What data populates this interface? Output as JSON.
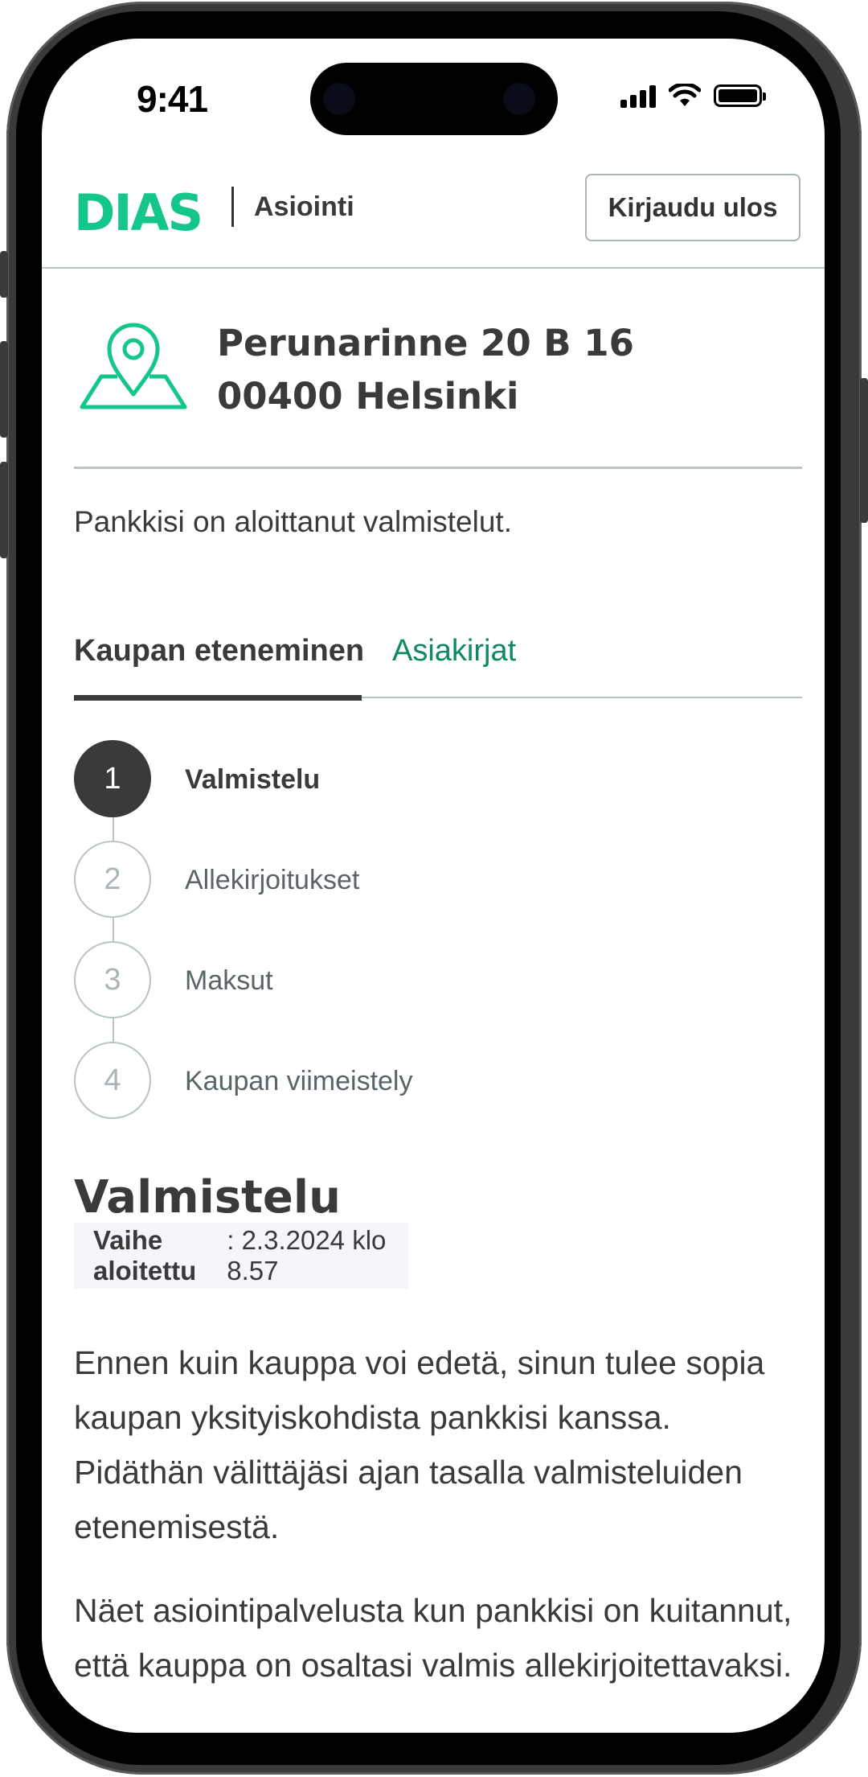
{
  "status_bar": {
    "time": "9:41"
  },
  "header": {
    "logo": "DIAS",
    "subtitle": "Asiointi",
    "logout_label": "Kirjaudu ulos"
  },
  "address": {
    "street": "Perunarinne 20 B 16",
    "city": "00400 Helsinki"
  },
  "status_message": "Pankkisi on aloittanut valmistelut.",
  "tabs": [
    {
      "label": "Kaupan eteneminen",
      "active": true
    },
    {
      "label": "Asiakirjat",
      "active": false
    }
  ],
  "steps": [
    {
      "number": "1",
      "label": "Valmistelu",
      "state": "current"
    },
    {
      "number": "2",
      "label": "Allekirjoitukset",
      "state": "upcoming"
    },
    {
      "number": "3",
      "label": "Maksut",
      "state": "upcoming"
    },
    {
      "number": "4",
      "label": "Kaupan viimeistely",
      "state": "upcoming"
    }
  ],
  "section": {
    "title": "Valmistelu",
    "phase_label": "Vaihe aloitettu",
    "phase_value": ": 2.3.2024 klo 8.57",
    "paragraph1": "Ennen kuin kauppa voi edetä, sinun tulee sopia kaupan yksityiskohdista pankkisi kanssa. Pidäthän välittäjäsi ajan tasalla valmisteluiden etenemisestä.",
    "paragraph2": "Näet asiointipalvelusta kun pankkisi on kuitannut, että kauppa on osaltasi valmis allekirjoitettavaksi."
  },
  "colors": {
    "brand": "#14c68a",
    "link": "#0e8a5f",
    "text": "#3a3a3a",
    "border": "#b8c4c6"
  }
}
